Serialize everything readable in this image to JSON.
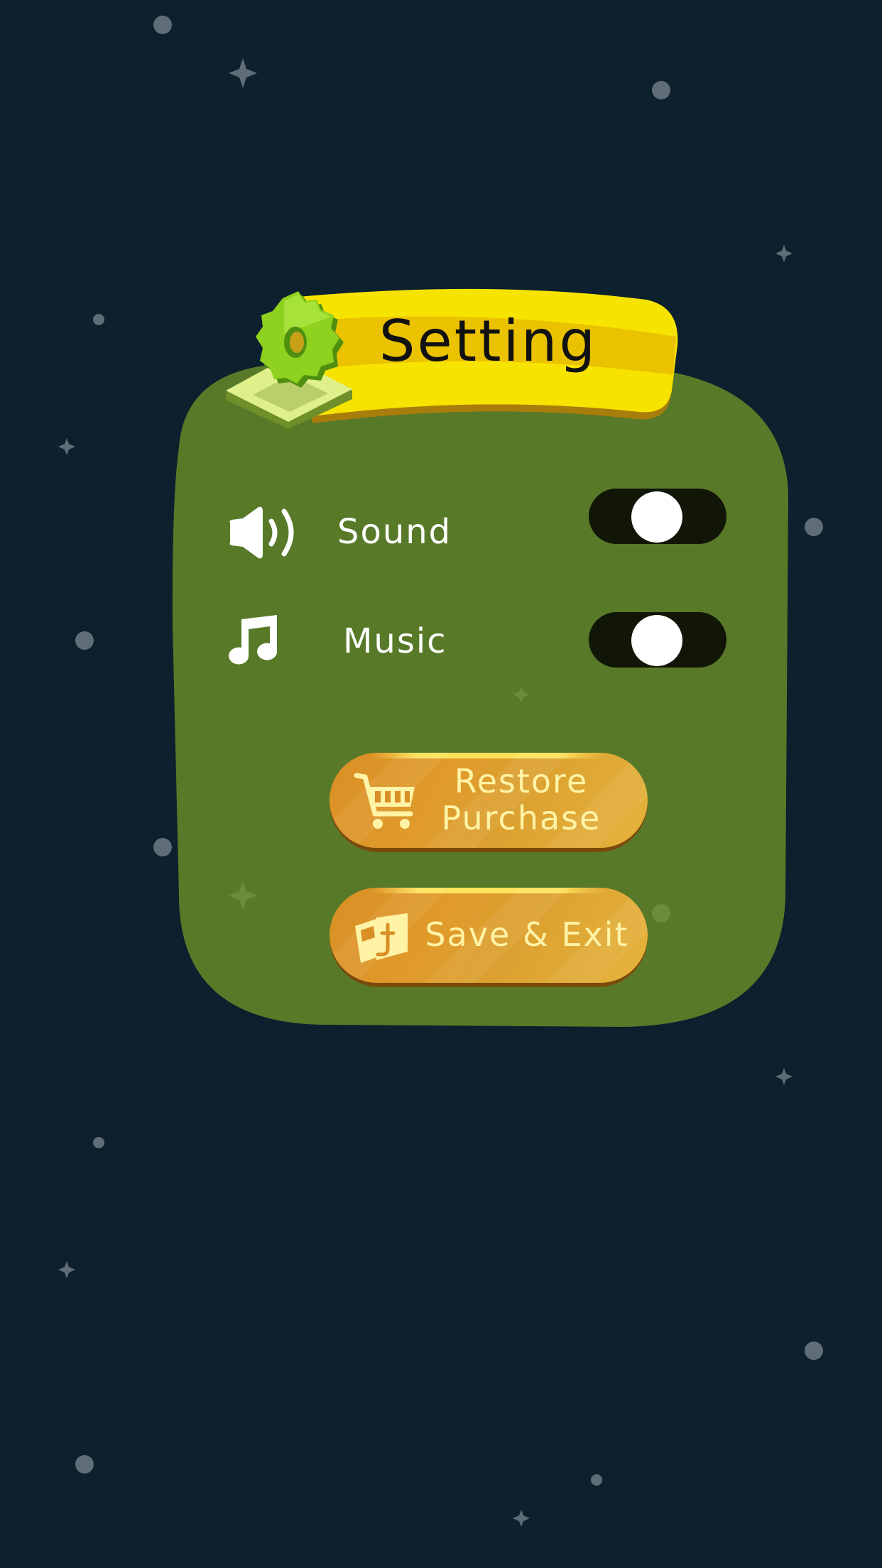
{
  "title": "Setting",
  "settings": {
    "sound": {
      "label": "Sound",
      "enabled": true
    },
    "music": {
      "label": "Music",
      "enabled": true
    }
  },
  "buttons": {
    "restore": {
      "line1": "Restore",
      "line2": "Purchase"
    },
    "save_exit": {
      "label": "Save & Exit"
    }
  },
  "colors": {
    "background": "#0d202d",
    "panel": "#587a28",
    "banner": "#f7e300",
    "button": "#dc962a",
    "button_text": "#fff3a6",
    "toggle_track": "#111607"
  },
  "icons": {
    "header": "gear-icon",
    "sound": "speaker-icon",
    "music": "music-note-icon",
    "restore": "shopping-cart-icon",
    "save_exit": "save-exit-icon"
  }
}
